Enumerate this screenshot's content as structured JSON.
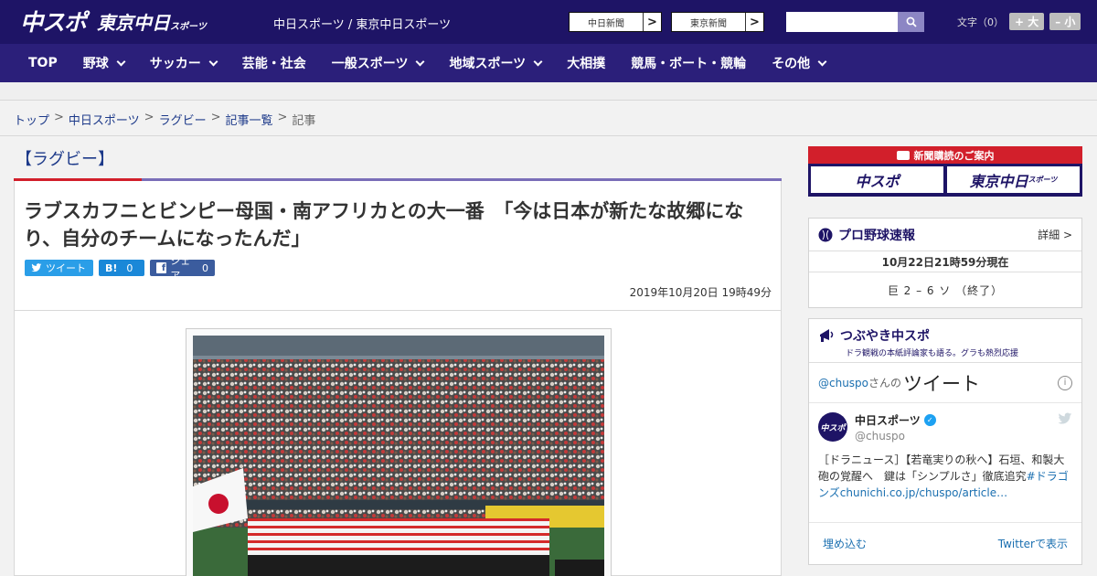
{
  "header": {
    "logo_main": "中スポ",
    "logo_sub": "東京中日",
    "logo_sub_small": "スポーツ",
    "site_title": "中日スポーツ / 東京中日スポーツ",
    "paper_buttons": [
      {
        "label": "中日新聞",
        "arrow": ">"
      },
      {
        "label": "東京新聞",
        "arrow": ">"
      }
    ],
    "search_placeholder": "",
    "font_label": "文字（0）",
    "font_larger": "+ 大",
    "font_smaller": "– 小"
  },
  "nav": {
    "items": [
      {
        "label": "TOP",
        "dropdown": false
      },
      {
        "label": "野球",
        "dropdown": true
      },
      {
        "label": "サッカー",
        "dropdown": true
      },
      {
        "label": "芸能・社会",
        "dropdown": false
      },
      {
        "label": "一般スポーツ",
        "dropdown": true
      },
      {
        "label": "地域スポーツ",
        "dropdown": true
      },
      {
        "label": "大相撲",
        "dropdown": false
      },
      {
        "label": "競馬・ボート・競輪",
        "dropdown": false
      },
      {
        "label": "その他",
        "dropdown": true
      }
    ]
  },
  "breadcrumb": {
    "items": [
      "トップ",
      "中日スポーツ",
      "ラグビー",
      "記事一覧"
    ],
    "current": "記事",
    "separator": ">"
  },
  "article": {
    "section": "【ラグビー】",
    "headline": "ラブスカフニとビンピー母国・南アフリカとの大一番　「今は日本が新たな故郷になり、自分のチームになったんだ」",
    "share_tweet": "ツイート",
    "share_hatena_icon": "B!",
    "share_hatena_count": "0",
    "share_facebook": "シェア",
    "share_facebook_count": "0",
    "date": "2019年10月20日 19時49分"
  },
  "sidebar": {
    "subscribe_head": "新聞購読のご案内",
    "subscribe_btn1": "中スポ",
    "subscribe_btn2": "東京中日",
    "subscribe_btn2_small": "スポーツ",
    "baseball_title": "プロ野球速報",
    "baseball_more": "詳細 >",
    "baseball_time": "10月22日21時59分現在",
    "baseball_score": "巨 2 – 6 ソ （終了）",
    "tweet_title": "つぶやき中スポ",
    "tweet_sub": "ドラ観戦の本紙評論家も語る。グラも熱烈応援",
    "tweet_handle": "@chuspo",
    "tweet_by": "さんの",
    "tweet_word": "ツイート",
    "tweet_user": "中日スポーツ",
    "tweet_user_at": "@chuspo",
    "tweet_avatar": "中スポ",
    "tweet_text": "［ドラニュース］【若竜実りの秋へ】石垣、和製大砲の覚醒へ　鍵は「シンプルさ」徹底追究",
    "tweet_hashtag": "#ドラゴンズ",
    "tweet_link": "chunichi.co.jp/chuspo/article…",
    "tweet_embed": "埋め込む",
    "tweet_view": "Twitterで表示"
  },
  "colors": {
    "header_bg": "#1e1466",
    "nav_bg": "#2b1f7a",
    "accent_red": "#d21f2b",
    "link_blue": "#1d3a8a"
  }
}
